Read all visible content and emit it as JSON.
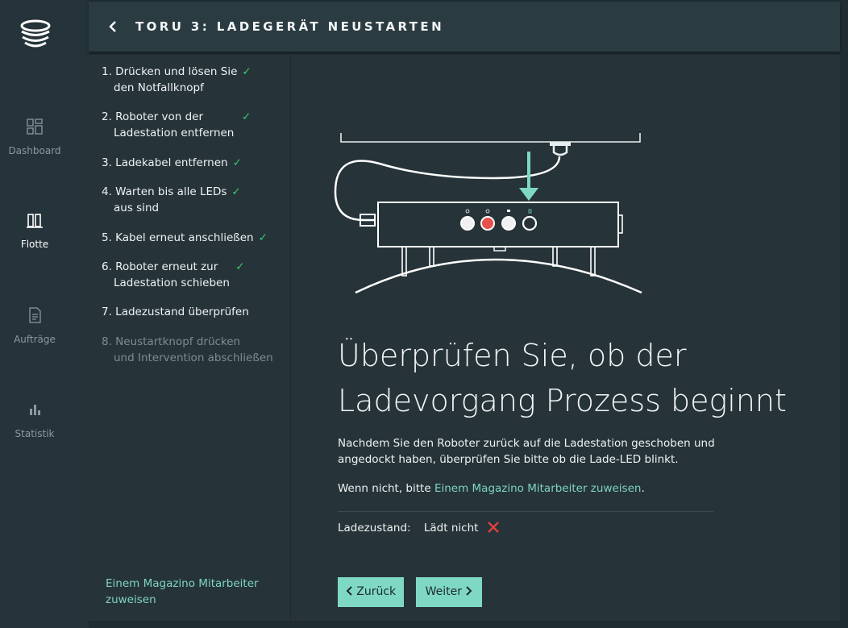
{
  "nav": {
    "items": [
      {
        "label": "Dashboard",
        "icon": "dashboard-icon",
        "active": false
      },
      {
        "label": "Flotte",
        "icon": "fleet-icon",
        "active": true
      },
      {
        "label": "Aufträge",
        "icon": "document-icon",
        "active": false
      },
      {
        "label": "Statistik",
        "icon": "bar-chart-icon",
        "active": false
      }
    ]
  },
  "header": {
    "title": "TORU 3: LADEGERÄT NEUSTARTEN"
  },
  "steps": [
    {
      "line1": "1. Drücken und lösen Sie",
      "line2": "den Notfallknopf",
      "done": true
    },
    {
      "line1": "2. Roboter von der",
      "line2": "Ladestation entfernen",
      "done": true
    },
    {
      "line1": "3. Ladekabel entfernen",
      "line2": "",
      "done": true
    },
    {
      "line1": "4. Warten bis alle LEDs",
      "line2": "aus sind",
      "done": true
    },
    {
      "line1": "5. Kabel erneut anschließen",
      "line2": "",
      "done": true
    },
    {
      "line1": "6. Roboter erneut zur",
      "line2": "Ladestation schieben",
      "done": true
    },
    {
      "line1": "7. Ladezustand überprüfen",
      "line2": "",
      "done": false
    },
    {
      "line1": "8. Neustartknopf drücken",
      "line2": "und Intervention abschließen",
      "done": false
    }
  ],
  "check_mark": "✓",
  "sidebar_link": "Einem Magazino Mitarbeiter zuweisen",
  "main": {
    "heading_line1": "Überprüfen Sie, ob der",
    "heading_line2": "Ladevorgang Prozess beginnt",
    "desc": "Nachdem Sie den Roboter zurück auf die Ladestation geschoben und angedockt haben, überprüfen Sie bitte ob die Lade-LED blinkt.",
    "note_prefix": "Wenn nicht, bitte ",
    "note_link": "Einem Magazino Mitarbeiter zuweisen",
    "note_suffix": ".",
    "status_label": "Ladezustand:",
    "status_value": "Lädt nicht",
    "back_button": "Zurück",
    "next_button": "Weiter"
  },
  "colors": {
    "accent": "#7fd8c4",
    "check": "#3ac86b",
    "error": "#e0403f",
    "led_red": "#e8504c"
  }
}
